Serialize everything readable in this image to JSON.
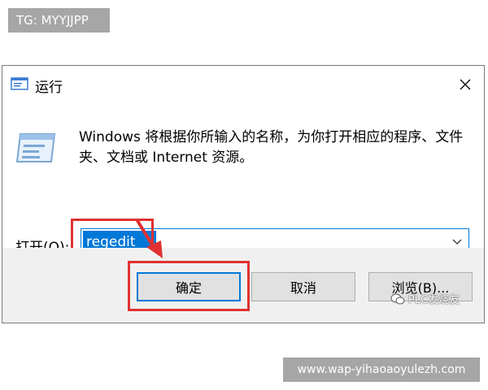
{
  "overlay": {
    "tg_label": "TG: MYYJJPP",
    "site_label": "www.wap-yihaoaoyulezh.com",
    "watermark_text": "PLC发烧友"
  },
  "dialog": {
    "title": "运行",
    "description": "Windows 将根据你所输入的名称，为你打开相应的程序、文件夹、文档或 Internet 资源。",
    "open_label": "打开(",
    "open_accel": "O",
    "open_label_suffix": "):",
    "input_value": "regedit",
    "buttons": {
      "ok": "确定",
      "cancel": "取消",
      "browse": "浏览(B)..."
    }
  },
  "colors": {
    "accent": "#0078d7",
    "highlight": "#e03131",
    "footer_bg": "#f0f0f0",
    "overlay_bg": "#a6a6a6"
  },
  "icons": {
    "title": "run-window-icon",
    "close": "close-icon",
    "dropdown": "chevron-down-icon",
    "run": "run-window-icon",
    "arrow": "red-arrow-icon",
    "watermark": "wechat-icon"
  }
}
